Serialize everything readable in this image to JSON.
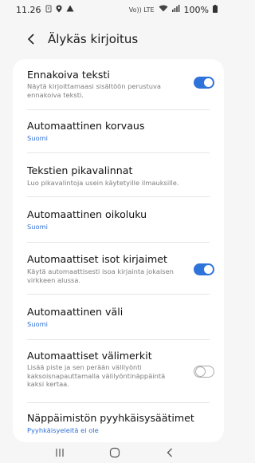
{
  "status": {
    "time": "11.26",
    "signal_text": "Vo)) LTE",
    "battery": "100%",
    "icons": [
      "alarm-icon",
      "location-icon",
      "warning-icon",
      "wifi-icon",
      "signal-icon",
      "battery-icon"
    ]
  },
  "header": {
    "title": "Älykäs kirjoitus"
  },
  "items": [
    {
      "title": "Ennakoiva teksti",
      "subtitle_lines": [
        "Näytä kirjoittamaasi sisältöön perustuva",
        "ennakoiva teksti."
      ],
      "toggle": "on"
    },
    {
      "title": "Automaattinen korvaus",
      "value": "Suomi"
    },
    {
      "title": "Tekstien pikavalinnat",
      "subtitle_lines": [
        "Luo pikavalintoja usein käytetyille ilmauksille."
      ]
    },
    {
      "title": "Automaattinen oikoluku",
      "value": "Suomi"
    },
    {
      "title": "Automaattiset isot kirjaimet",
      "subtitle_lines": [
        "Käytä automaattisesti isoa kirjainta jokaisen",
        "virkkeen alussa."
      ],
      "toggle": "on"
    },
    {
      "title": "Automaattinen väli",
      "value": "Suomi"
    },
    {
      "title": "Automaattiset välimerkit",
      "subtitle_lines": [
        "Lisää piste ja sen perään välilyönti",
        "kaksoisnapauttamalla välilyöntinäppäintä",
        "kaksi kertaa."
      ],
      "toggle": "off"
    },
    {
      "title": "Näppäimistön pyyhkäisysäätimet",
      "value": "Pyyhkäisyeleitä ei ole"
    }
  ],
  "colors": {
    "accent": "#2e73da",
    "value_text": "#2f6fd6",
    "background": "#f6f6f6",
    "card": "#ffffff"
  }
}
